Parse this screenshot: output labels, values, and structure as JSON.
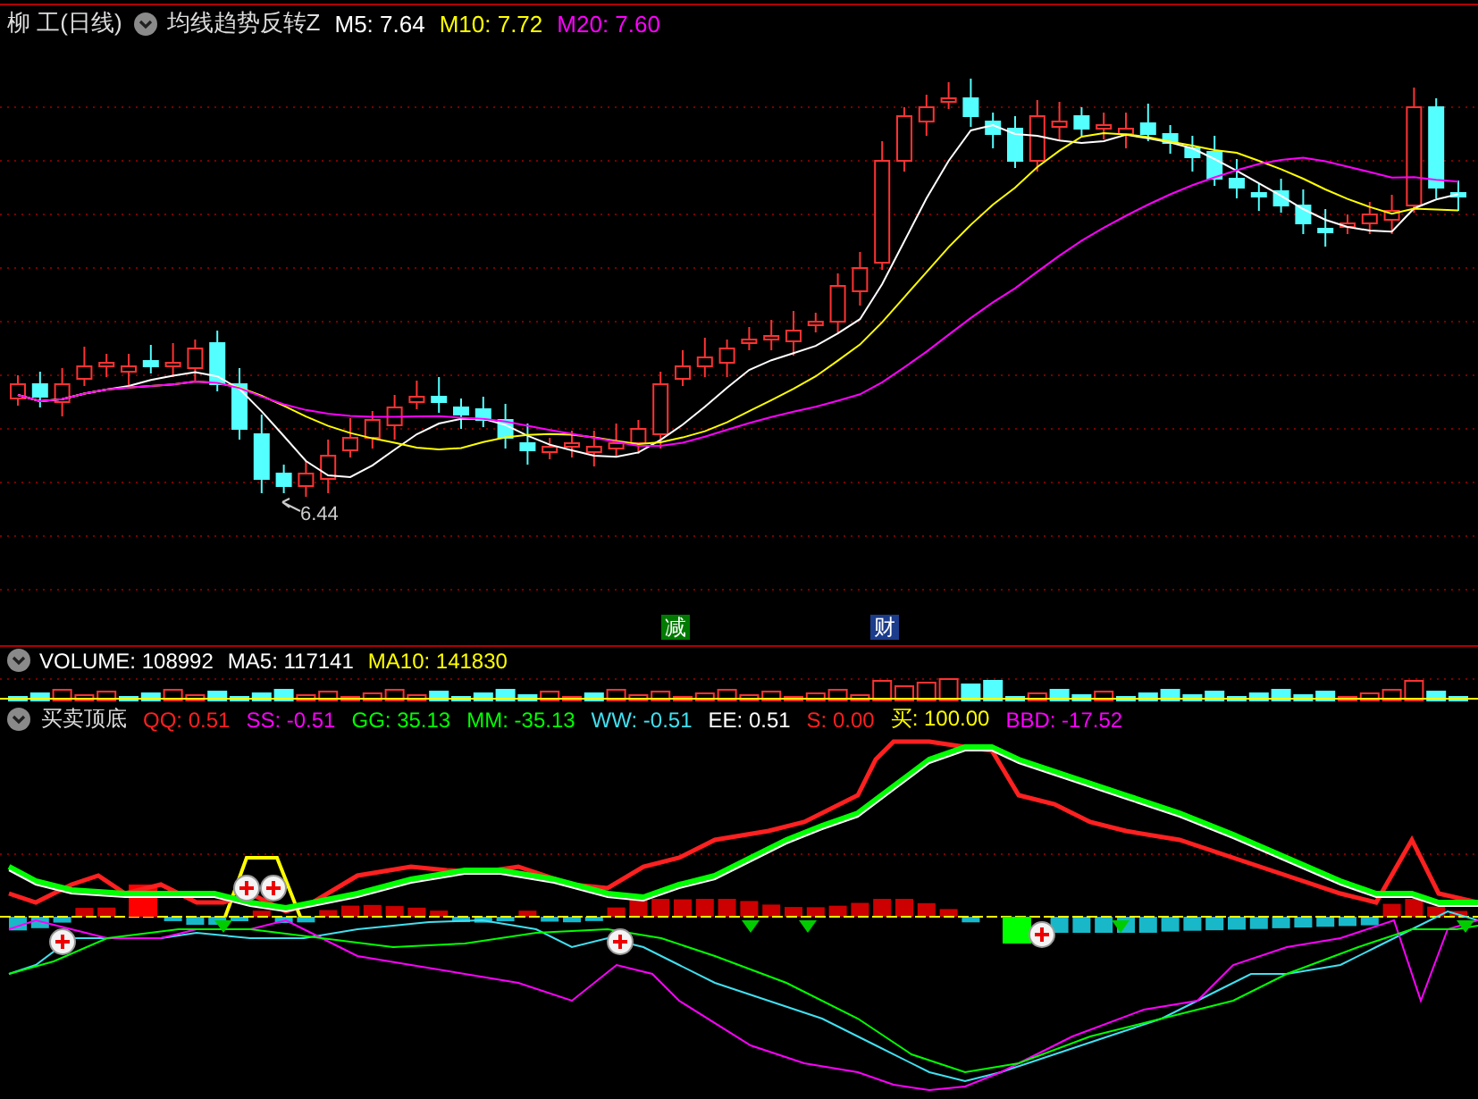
{
  "main_header": {
    "stock": "柳 工(日线)",
    "indicator": "均线趋势反转Z",
    "values": [
      {
        "text": "M5: 7.64",
        "color": "#ffffff"
      },
      {
        "text": "M10: 7.72",
        "color": "#ffff00"
      },
      {
        "text": "M20: 7.60",
        "color": "#ff00ff"
      }
    ]
  },
  "low_label": "6.44",
  "badges": [
    {
      "text": "减",
      "color": "#007a00"
    },
    {
      "text": "财",
      "color": "#1c3c8c"
    }
  ],
  "volume_header": {
    "values": [
      {
        "text": "VOLUME: 108992",
        "color": "#ffffff"
      },
      {
        "text": "MA5: 117141",
        "color": "#ffffff"
      },
      {
        "text": "MA10: 141830",
        "color": "#ffff00"
      }
    ]
  },
  "indicator_header": {
    "title": "买卖顶底",
    "values": [
      {
        "text": "QQ: 0.51",
        "color": "#ff2020"
      },
      {
        "text": "SS: -0.51",
        "color": "#ff00ff"
      },
      {
        "text": "GG: 35.13",
        "color": "#00ff00"
      },
      {
        "text": "MM: -35.13",
        "color": "#00ff00"
      },
      {
        "text": "WW: -0.51",
        "color": "#40e0f0"
      },
      {
        "text": "EE: 0.51",
        "color": "#ffffff"
      },
      {
        "text": "S: 0.00",
        "color": "#ff2020"
      },
      {
        "text": "买: 100.00",
        "color": "#ffff00"
      },
      {
        "text": "BBD: -17.52",
        "color": "#ff00ff"
      }
    ]
  }
}
